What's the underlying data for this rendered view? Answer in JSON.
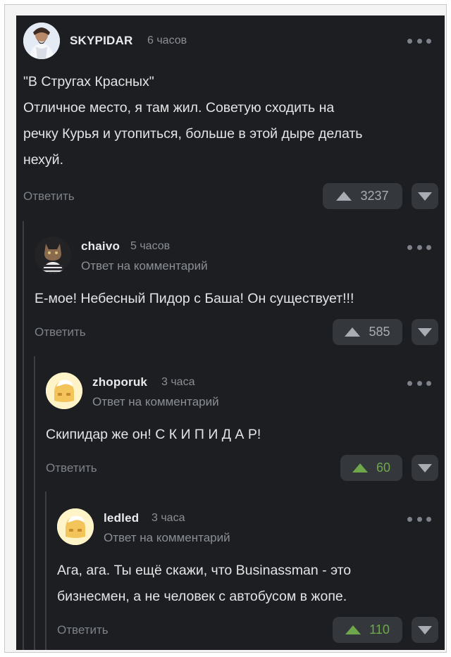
{
  "comments": [
    {
      "user": "SKYPIDAR",
      "time": "6 часов",
      "reply_to": "",
      "text_lines": [
        "\"В Стругах Красных\"",
        "Отличное место, я там жил. Советую сходить на",
        "речку Курья и утопиться, больше в этой дыре делать",
        "нехуй."
      ],
      "reply_label": "Ответить",
      "rating": "3237",
      "rating_color": "#a9adb3"
    },
    {
      "user": "chaivo",
      "time": "5 часов",
      "reply_to": "Ответ на комментарий",
      "text_lines": [
        "Е-мое! Небесный Пидор с Баша! Он существует!!!"
      ],
      "reply_label": "Ответить",
      "rating": "585",
      "rating_color": "#a9adb3"
    },
    {
      "user": "zhoporuk",
      "time": "3 часа",
      "reply_to": "Ответ на комментарий",
      "text_lines": [
        "Скипидар же он! С К И П И Д А Р!"
      ],
      "reply_label": "Ответить",
      "rating": "60",
      "rating_color": "#6ea84a"
    },
    {
      "user": "ledled",
      "time": "3 часа",
      "reply_to": "Ответ на комментарий",
      "text_lines": [
        "Ага, ага. Ты ещё скажи, что Businassman - это",
        "бизнесмен, а не человек с автобусом в жопе."
      ],
      "reply_label": "Ответить",
      "rating": "110",
      "rating_color": "#6ea84a"
    }
  ]
}
